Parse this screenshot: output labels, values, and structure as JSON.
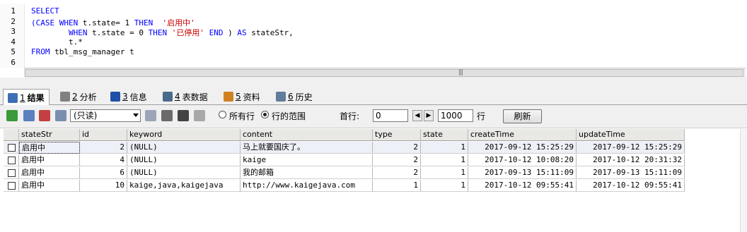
{
  "editor": {
    "line_numbers": [
      "1",
      "2",
      "3",
      "4",
      "5",
      "6"
    ],
    "lines": [
      [
        {
          "t": "SELECT",
          "c": "kw"
        }
      ],
      [
        {
          "t": "(CASE WHEN ",
          "c": "kw"
        },
        {
          "t": "t.state= 1 ",
          "c": "plain"
        },
        {
          "t": "THEN  ",
          "c": "kw"
        },
        {
          "t": "'启用中'",
          "c": "str"
        }
      ],
      [
        {
          "t": "        WHEN ",
          "c": "kw"
        },
        {
          "t": "t.state = 0 ",
          "c": "plain"
        },
        {
          "t": "THEN ",
          "c": "kw"
        },
        {
          "t": "'已停用' ",
          "c": "str"
        },
        {
          "t": "END ",
          "c": "kw"
        },
        {
          "t": ") ",
          "c": "plain"
        },
        {
          "t": "AS ",
          "c": "kw"
        },
        {
          "t": "stateStr,",
          "c": "plain"
        }
      ],
      [
        {
          "t": "        t.*",
          "c": "plain"
        }
      ],
      [
        {
          "t": "FROM ",
          "c": "kw"
        },
        {
          "t": "tbl_msg_manager t",
          "c": "plain"
        }
      ],
      []
    ]
  },
  "tabs": [
    {
      "num": "1",
      "label": "结果",
      "icon": "result-grid-icon",
      "active": true
    },
    {
      "num": "2",
      "label": "分析",
      "icon": "profiler-icon",
      "active": false
    },
    {
      "num": "3",
      "label": "信息",
      "icon": "info-icon",
      "active": false
    },
    {
      "num": "4",
      "label": "表数据",
      "icon": "table-data-icon",
      "active": false
    },
    {
      "num": "5",
      "label": "资料",
      "icon": "info-chart-icon",
      "active": false
    },
    {
      "num": "6",
      "label": "历史",
      "icon": "history-icon",
      "active": false
    }
  ],
  "toolbar": {
    "mode_select": "(只读)",
    "radio_all_rows": "所有行",
    "radio_range": "行的范围",
    "first_row_label": "首行:",
    "first_row_value": "0",
    "row_count_value": "1000",
    "rows_suffix": "行",
    "refresh_label": "刷新"
  },
  "grid": {
    "columns": [
      "stateStr",
      "id",
      "keyword",
      "content",
      "type",
      "state",
      "createTime",
      "updateTime"
    ],
    "rows": [
      [
        "启用中",
        "2",
        "(NULL)",
        "马上就要国庆了。",
        "2",
        "1",
        "2017-09-12 15:25:29",
        "2017-09-12 15:25:29"
      ],
      [
        "启用中",
        "4",
        "(NULL)",
        "kaige",
        "2",
        "1",
        "2017-10-12 10:08:20",
        "2017-10-12 20:31:32"
      ],
      [
        "启用中",
        "6",
        "(NULL)",
        "我的邮箱",
        "2",
        "1",
        "2017-09-13 15:11:09",
        "2017-09-13 15:11:09"
      ],
      [
        "启用中",
        "10",
        "kaige,java,kaigejava",
        "http://www.kaigejava.com",
        "1",
        "1",
        "2017-10-12 09:55:41",
        "2017-10-12 09:55:41"
      ]
    ]
  },
  "colors": {
    "keyword": "#0000ff",
    "string": "#cc0000",
    "row_alt": "#eef0f8"
  }
}
